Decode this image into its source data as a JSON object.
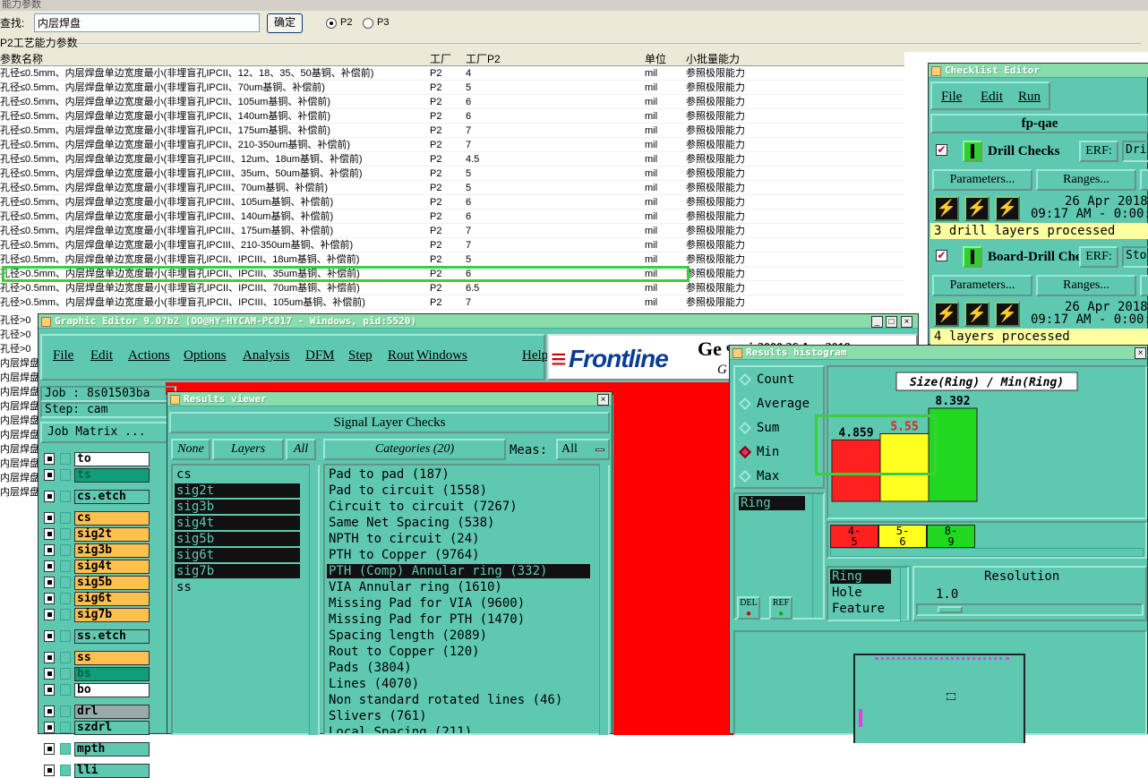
{
  "top_window": {
    "caption": "能力参数",
    "search_label": "查找:",
    "search_value": "内层焊盘",
    "confirm_label": "确定",
    "radio_p2": "P2",
    "radio_p3": "P3",
    "selected": "P2",
    "group_label": "P2工艺能力参数",
    "columns": [
      "参数名称",
      "工厂",
      "工厂P2",
      "单位",
      "小批量能力"
    ],
    "rows": [
      [
        "孔径≤0.5mm、内层焊盘单边宽度最小(非埋盲孔IPCII、12、18、35、50基铜、补偿前)",
        "P2",
        "4",
        "mil",
        "参照极限能力"
      ],
      [
        "孔径≤0.5mm、内层焊盘单边宽度最小(非埋盲孔IPCII、70um基铜、补偿前)",
        "P2",
        "5",
        "mil",
        "参照极限能力"
      ],
      [
        "孔径≤0.5mm、内层焊盘单边宽度最小(非埋盲孔IPCII、105um基铜、补偿前)",
        "P2",
        "6",
        "mil",
        "参照极限能力"
      ],
      [
        "孔径≤0.5mm、内层焊盘单边宽度最小(非埋盲孔IPCII、140um基铜、补偿前)",
        "P2",
        "6",
        "mil",
        "参照极限能力"
      ],
      [
        "孔径≤0.5mm、内层焊盘单边宽度最小(非埋盲孔IPCII、175um基铜、补偿前)",
        "P2",
        "7",
        "mil",
        "参照极限能力"
      ],
      [
        "孔径≤0.5mm、内层焊盘单边宽度最小(非埋盲孔IPCII、210-350um基铜、补偿前)",
        "P2",
        "7",
        "mil",
        "参照极限能力"
      ],
      [
        "孔径≤0.5mm、内层焊盘单边宽度最小(非埋盲孔IPCIII、12um、18um基铜、补偿前)",
        "P2",
        "4.5",
        "mil",
        "参照极限能力"
      ],
      [
        "孔径≤0.5mm、内层焊盘单边宽度最小(非埋盲孔IPCIII、35um、50um基铜、补偿前)",
        "P2",
        "5",
        "mil",
        "参照极限能力"
      ],
      [
        "孔径≤0.5mm、内层焊盘单边宽度最小(非埋盲孔IPCIII、70um基铜、补偿前)",
        "P2",
        "5",
        "mil",
        "参照极限能力"
      ],
      [
        "孔径≤0.5mm、内层焊盘单边宽度最小(非埋盲孔IPCIII、105um基铜、补偿前)",
        "P2",
        "6",
        "mil",
        "参照极限能力"
      ],
      [
        "孔径≤0.5mm、内层焊盘单边宽度最小(非埋盲孔IPCIII、140um基铜、补偿前)",
        "P2",
        "6",
        "mil",
        "参照极限能力"
      ],
      [
        "孔径≤0.5mm、内层焊盘单边宽度最小(非埋盲孔IPCIII、175um基铜、补偿前)",
        "P2",
        "7",
        "mil",
        "参照极限能力"
      ],
      [
        "孔径≤0.5mm、内层焊盘单边宽度最小(非埋盲孔IPCIII、210-350um基铜、补偿前)",
        "P2",
        "7",
        "mil",
        "参照极限能力"
      ],
      [
        "孔径≤0.5mm、内层焊盘单边宽度最小(非埋盲孔IPCII、IPCIII、18um基铜、补偿前)",
        "P2",
        "5",
        "mil",
        "参照极限能力"
      ],
      [
        "孔径>0.5mm、内层焊盘单边宽度最小(非埋盲孔IPCII、IPCIII、35um基铜、补偿前)",
        "P2",
        "6",
        "mil",
        "参照极限能力"
      ],
      [
        "孔径>0.5mm、内层焊盘单边宽度最小(非埋盲孔IPCII、IPCIII、70um基铜、补偿前)",
        "P2",
        "6.5",
        "mil",
        "参照极限能力"
      ],
      [
        "孔径>0.5mm、内层焊盘单边宽度最小(非埋盲孔IPCII、IPCIII、105um基铜、补偿前)",
        "P2",
        "7",
        "mil",
        "参照极限能力"
      ]
    ],
    "left_fragments": [
      "孔径>0",
      "孔径>0",
      "孔径>0",
      "内层焊盘",
      "内层焊盘",
      "内层焊盘",
      "内层焊盘",
      "内层焊盘",
      "内层焊盘",
      "内层焊盘",
      "内层焊盘",
      "内层焊盘",
      "内层焊盘"
    ]
  },
  "checklist": {
    "title": "Checklist Editor",
    "menu": [
      "File",
      "Edit",
      "Run"
    ],
    "name": "fp-qae",
    "checks": [
      {
        "label": "Drill Checks",
        "erf": "ERF:",
        "erf_value": "Dri",
        "params": "Parameters...",
        "ranges": "Ranges...",
        "date": "26 Apr 2018",
        "time": "09:17 AM - 0:00:",
        "status": "3 drill layers processed"
      },
      {
        "label": "Board-Drill Che",
        "erf": "ERF:",
        "erf_value": "Sto",
        "params": "Parameters...",
        "ranges": "Ranges...",
        "date": "26 Apr 2018",
        "time": "09:17 AM - 0:00:",
        "status": "4 layers processed"
      }
    ]
  },
  "graphic_editor": {
    "title": "Graphic Editor 9.0?b2 (OO@HY-HYCAM-PC017 - Windows, pid:5520)",
    "menu": [
      "File",
      "Edit",
      "Actions",
      "Options",
      "Analysis",
      "DFM",
      "Step",
      "Rout",
      "Windows",
      "Help"
    ],
    "logo": "Frontline",
    "genesis_text": "Ge",
    "genesis_text2": "enesis2000 26 Apr 2018",
    "genesis_sub": "G",
    "job": "Job : 8s01503ba",
    "step": "Step: cam",
    "job_matrix": "Job Matrix ...",
    "layers": [
      {
        "name": "to",
        "color": "#ffffff"
      },
      {
        "name": "ts",
        "color": "#0f9d7a"
      },
      {
        "name": "cs.etch",
        "color": "#5fc8b0"
      },
      {
        "name": "cs",
        "color": "#ffc04d"
      },
      {
        "name": "sig2t",
        "color": "#ffc04d"
      },
      {
        "name": "sig3b",
        "color": "#ffc04d"
      },
      {
        "name": "sig4t",
        "color": "#ffc04d"
      },
      {
        "name": "sig5b",
        "color": "#ffc04d"
      },
      {
        "name": "sig6t",
        "color": "#ffc04d"
      },
      {
        "name": "sig7b",
        "color": "#ffc04d"
      },
      {
        "name": "ss.etch",
        "color": "#5fc8b0"
      },
      {
        "name": "ss",
        "color": "#ffc04d"
      },
      {
        "name": "bs",
        "color": "#0f9d7a"
      },
      {
        "name": "bo",
        "color": "#ffffff"
      },
      {
        "name": "drl",
        "color": "#9aa"
      },
      {
        "name": "szdrl",
        "color": "#5fc8b0"
      },
      {
        "name": "mpth",
        "color": "#5fc8b0"
      },
      {
        "name": "lli",
        "color": "#5fc8b0"
      }
    ]
  },
  "results_viewer": {
    "title": "Results viewer",
    "header": "Signal Layer Checks",
    "none_btn": "None",
    "layers_btn": "Layers",
    "all_btn": "All",
    "categories_label": "Categories (20)",
    "meas_label": "Meas:",
    "meas_value": "All",
    "layer_items": [
      {
        "name": "cs",
        "selected": false
      },
      {
        "name": "sig2t",
        "selected": true
      },
      {
        "name": "sig3b",
        "selected": true
      },
      {
        "name": "sig4t",
        "selected": true
      },
      {
        "name": "sig5b",
        "selected": true
      },
      {
        "name": "sig6t",
        "selected": true
      },
      {
        "name": "sig7b",
        "selected": true
      },
      {
        "name": "ss",
        "selected": false
      }
    ],
    "categories": [
      {
        "name": "Pad to pad (187)",
        "selected": false
      },
      {
        "name": "Pad to circuit (1558)",
        "selected": false
      },
      {
        "name": "Circuit to circuit (7267)",
        "selected": false
      },
      {
        "name": "Same Net Spacing (538)",
        "selected": false
      },
      {
        "name": "NPTH to circuit (24)",
        "selected": false
      },
      {
        "name": "PTH to Copper (9764)",
        "selected": false
      },
      {
        "name": "PTH (Comp) Annular ring (332)",
        "selected": true
      },
      {
        "name": "VIA Annular ring (1610)",
        "selected": false
      },
      {
        "name": "Missing Pad for VIA (9600)",
        "selected": false
      },
      {
        "name": "Missing Pad for PTH (1470)",
        "selected": false
      },
      {
        "name": "Spacing length (2089)",
        "selected": false
      },
      {
        "name": "Rout to Copper (120)",
        "selected": false
      },
      {
        "name": "Pads (3804)",
        "selected": false
      },
      {
        "name": "Lines (4070)",
        "selected": false
      },
      {
        "name": "Non standard rotated lines (46)",
        "selected": false
      },
      {
        "name": "Slivers (761)",
        "selected": false
      },
      {
        "name": "Local Spacing (211)",
        "selected": false
      }
    ]
  },
  "histogram": {
    "title": "Results histogram",
    "radios": [
      "Count",
      "Average",
      "Sum",
      "Min",
      "Max"
    ],
    "selected_radio": "Min",
    "measure_item": "Ring",
    "del_btn": "DEL",
    "ref_btn": "REF",
    "sort_items": [
      "Ring",
      "Hole",
      "Feature"
    ],
    "resolution_label": "Resolution",
    "resolution_value": "1.0",
    "chart_title": "Size(Ring) / Min(Ring)",
    "bin_labels": [
      "4-\n5",
      "5-\n6",
      "8-\n9"
    ],
    "colors": [
      "#ff2020",
      "#ffff20",
      "#20d820"
    ]
  },
  "chart_data": {
    "type": "bar",
    "title": "Size(Ring) / Min(Ring)",
    "categories": [
      "4-5",
      "5-6",
      "8-9"
    ],
    "values": [
      4.859,
      5.55,
      8.392
    ],
    "value_labels": [
      "4.859",
      "5.55",
      "8.392"
    ],
    "ylim": [
      0,
      8.392
    ]
  }
}
